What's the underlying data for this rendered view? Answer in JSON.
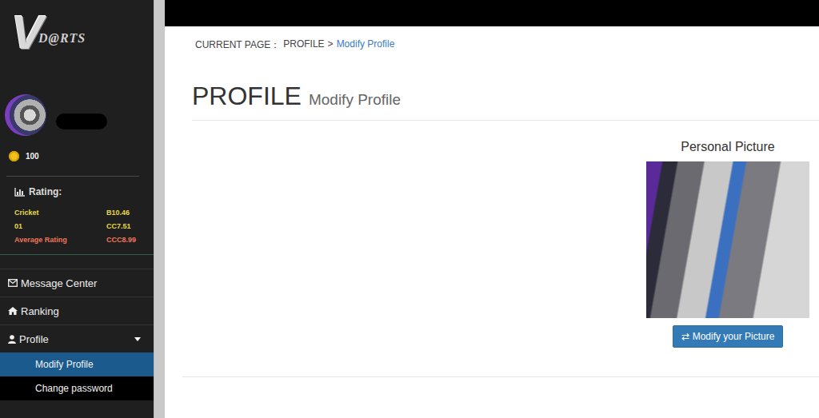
{
  "logo": {
    "initial": "V",
    "rest": "D@RTS"
  },
  "user": {
    "coins": "100"
  },
  "rating": {
    "title": "Rating:",
    "rows": [
      {
        "label": "Cricket",
        "value": "B10.46",
        "color": "#e6d84a"
      },
      {
        "label": "01",
        "value": "CC7.51",
        "color": "#e6d84a"
      },
      {
        "label": "Average Rating",
        "value": "CCC8.99",
        "color": "#f0745a"
      }
    ]
  },
  "menu": [
    {
      "label": "Message Center",
      "kind": "message",
      "expanded": false,
      "children": []
    },
    {
      "label": "Ranking",
      "kind": "ranking",
      "expanded": false,
      "children": []
    },
    {
      "label": "Profile",
      "kind": "profile",
      "expanded": true,
      "children": [
        {
          "label": "Modify Profile",
          "selected": true
        },
        {
          "label": "Change password",
          "selected": false
        }
      ]
    }
  ],
  "breadcrumb": {
    "prefix": "CURRENT PAGE：",
    "path": "PROFILE",
    "separator": ">",
    "current": "Modify Profile"
  },
  "page": {
    "title": "PROFILE",
    "subtitle": "Modify Profile"
  },
  "picture": {
    "label": "Personal Picture",
    "button_icon": "⇄",
    "button": "Modify your Picture"
  }
}
